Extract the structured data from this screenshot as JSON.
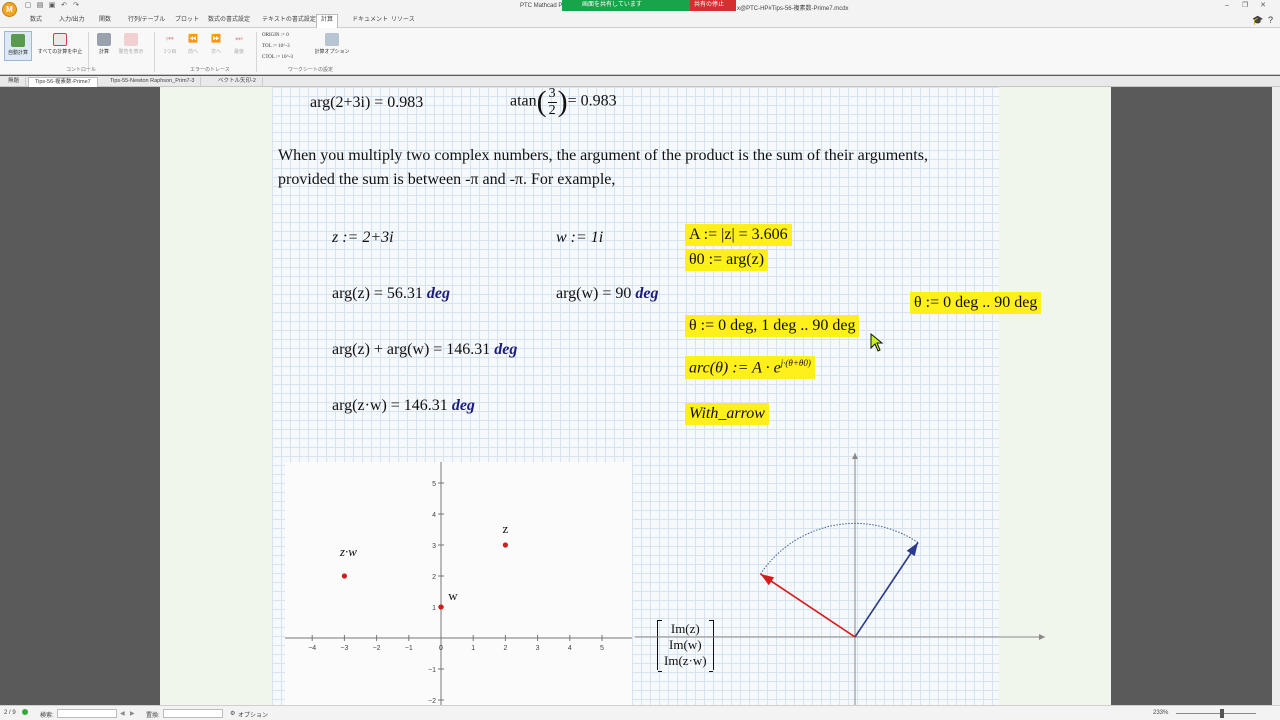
{
  "app": {
    "title": "PTC Mathcad Prime 7.0.0",
    "share_status": "画面を共有しています",
    "stop_share": "共有の停止",
    "file_title": "x@PTC-HP#Tips-56-複素数-Prime7.mcdx"
  },
  "ribbon": {
    "tabs": [
      "数式",
      "入力/出力",
      "関数",
      "行列/テーブル",
      "プロット",
      "数式の書式設定",
      "テキストの書式設定",
      "計算",
      "ドキュメント",
      "リソース"
    ],
    "active_tab": "計算",
    "buttons": {
      "auto_calc": "自動計算",
      "stop_all": "すべての計算を中止",
      "calc": "計算",
      "warning": "警告を表示",
      "first": "1つ目",
      "prev": "前へ",
      "next": "次へ",
      "last": "最後"
    },
    "groups": {
      "control": "コントロール",
      "error_trace": "エラーのトレース",
      "worksheet_settings": "ワークシートの設定"
    },
    "settings": {
      "origin": "ORIGIN := 0",
      "tol": "TOL := 10^-3",
      "ctol": "CTOL := 10^-3",
      "calc_options": "計算オプション"
    }
  },
  "doc_tabs": [
    "無題",
    "Tips-56-複素数-Prime7",
    "Tips-55-Newton Raphson_Prim7-3",
    "ベクトル矢印-2"
  ],
  "active_doc_tab": "Tips-56-複素数-Prime7",
  "worksheet": {
    "top_line_left": "arg(2+3i) = 0.983",
    "top_line_right_value": "= 0.983",
    "atan_num": "3",
    "atan_den": "2",
    "paragraph": "When you multiply two complex numbers, the argument of the product is the sum of their arguments, provided the sum is between -π and -π.  For example,",
    "z_def": "z := 2+3i",
    "w_def": "w := 1i",
    "A_def": "A := |z| = 3.606",
    "theta0_def": "θ0 := arg(z)",
    "arg_z": "arg(z) = 56.31",
    "arg_w": "arg(w) = 90",
    "theta_range_1": "θ := 0 deg, 1 deg .. 90 deg",
    "theta_range_2": "θ := 0 deg .. 90 deg",
    "arg_sum": "arg(z) + arg(w) = 146.31",
    "arc_def": "arc(θ) := A · e",
    "arc_exp": "j·(θ+θ0)",
    "arg_prod": "arg(z·w) = 146.31",
    "with_arrow": "With_arrow",
    "unit": "deg"
  },
  "chart_data": [
    {
      "type": "scatter",
      "series": [
        {
          "name": "",
          "values": [
            [
              2,
              3
            ],
            [
              0,
              1
            ],
            [
              -3,
              2
            ]
          ]
        }
      ],
      "point_labels": [
        "z",
        "w",
        "z·w"
      ],
      "xlim": [
        -4.6,
        6
      ],
      "ylim": [
        -2,
        6
      ],
      "x_ticks": [
        "−4",
        "−3",
        "−2",
        "−1",
        "0",
        "1",
        "2",
        "3",
        "4",
        "5"
      ],
      "y_ticks": [
        "−2",
        "−1",
        "0",
        "1",
        "2",
        "3",
        "4",
        "5"
      ],
      "y_axis_labels": [
        "Im(z)",
        "Im(w)",
        "Im(z·w)"
      ],
      "color": "#d41c1c"
    },
    {
      "type": "line",
      "vectors": [
        {
          "name": "z",
          "to": [
            2,
            3
          ],
          "color": "#2b3a8f"
        },
        {
          "name": "z·w",
          "to": [
            -3,
            2
          ],
          "color": "#d41c1c"
        }
      ],
      "arc_radius": 3.606,
      "arc_from_deg": 56.31,
      "arc_to_deg": 146.31,
      "color_arc": "#3b5c88"
    }
  ],
  "status": {
    "page": "2 / 9",
    "search_label": "検索:",
    "replace_label": "置換:",
    "options": "オプション",
    "zoom": "233%"
  }
}
